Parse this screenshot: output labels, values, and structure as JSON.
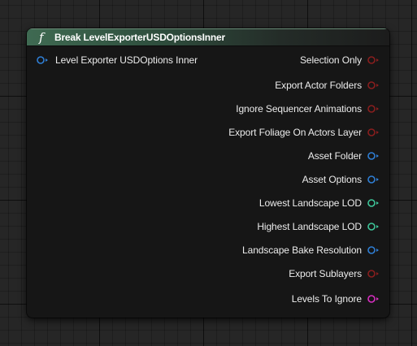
{
  "node": {
    "title": "Break LevelExporterUSDOptionsInner",
    "header_icon": "function-icon",
    "header_icon_glyph": "f",
    "input_pin": {
      "label": "Level Exporter USDOptions Inner",
      "color": "#2f7fd6",
      "type": "struct"
    },
    "output_pins": [
      {
        "label": "Selection Only",
        "color": "#8a1e1e",
        "type": "bool"
      },
      {
        "label": "Export Actor Folders",
        "color": "#8a1e1e",
        "type": "bool"
      },
      {
        "label": "Ignore Sequencer Animations",
        "color": "#8a1e1e",
        "type": "bool"
      },
      {
        "label": "Export Foliage On Actors Layer",
        "color": "#8a1e1e",
        "type": "bool"
      },
      {
        "label": "Asset Folder",
        "color": "#2f7fd6",
        "type": "struct"
      },
      {
        "label": "Asset Options",
        "color": "#2f7fd6",
        "type": "struct"
      },
      {
        "label": "Lowest Landscape LOD",
        "color": "#3ec79a",
        "type": "int"
      },
      {
        "label": "Highest Landscape LOD",
        "color": "#3ec79a",
        "type": "int"
      },
      {
        "label": "Landscape Bake Resolution",
        "color": "#2f7fd6",
        "type": "struct"
      },
      {
        "label": "Export Sublayers",
        "color": "#8a1e1e",
        "type": "bool"
      },
      {
        "label": "Levels To Ignore",
        "color": "#d92ec2",
        "type": "set"
      }
    ]
  },
  "colors": {
    "background": "#262626",
    "node_body": "#161616",
    "header_accent": "#3f6a52",
    "text": "#ececec"
  }
}
